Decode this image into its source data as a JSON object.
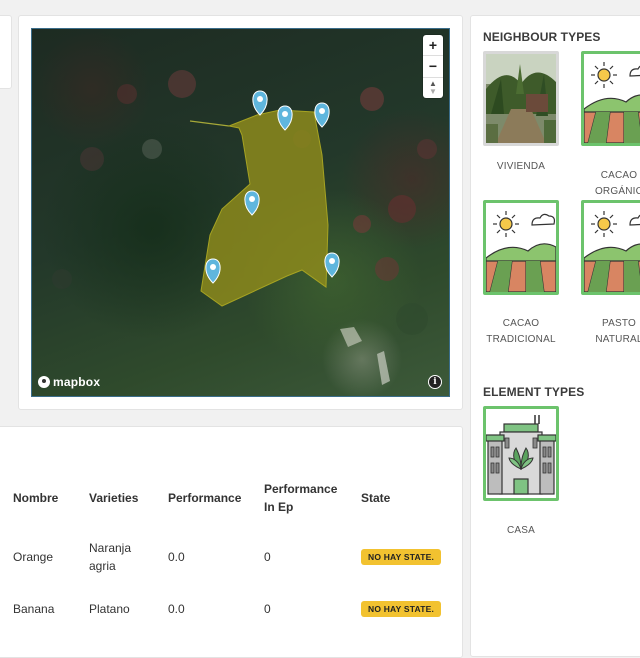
{
  "map": {
    "zoom_in": "+",
    "zoom_out": "−",
    "attribution": "mapbox",
    "info": "i"
  },
  "table": {
    "headers": [
      "Nombre",
      "Varieties",
      "Performance",
      "Performance In Ep",
      "State"
    ],
    "rows": [
      {
        "nombre": "Orange",
        "variety": "Naranja agria",
        "performance": "0.0",
        "performance_ep": "0",
        "state": "NO HAY STATE."
      },
      {
        "nombre": "Banana",
        "variety": "Platano",
        "performance": "0.0",
        "performance_ep": "0",
        "state": "NO HAY STATE."
      }
    ]
  },
  "neighbour": {
    "title": "NEIGHBOUR TYPES",
    "items": [
      {
        "label_l1": "VIVIENDA",
        "label_l2": "",
        "icon": "house-photo"
      },
      {
        "label_l1": "CACAO",
        "label_l2": "ORGÁNIC",
        "icon": "farm-field-icon"
      },
      {
        "label_l1": "CACAO",
        "label_l2": "TRADICIONAL",
        "icon": "farm-field-icon"
      },
      {
        "label_l1": "PASTO",
        "label_l2": "NATURAL",
        "icon": "farm-field-icon"
      }
    ]
  },
  "element": {
    "title": "ELEMENT TYPES",
    "items": [
      {
        "label": "CASA",
        "icon": "eco-building-icon"
      }
    ]
  },
  "colors": {
    "accent_green": "#6cc36c",
    "badge_yellow": "#f2c230",
    "marker_blue": "#5fb6dd",
    "polygon_olive": "#8c8a1c"
  }
}
